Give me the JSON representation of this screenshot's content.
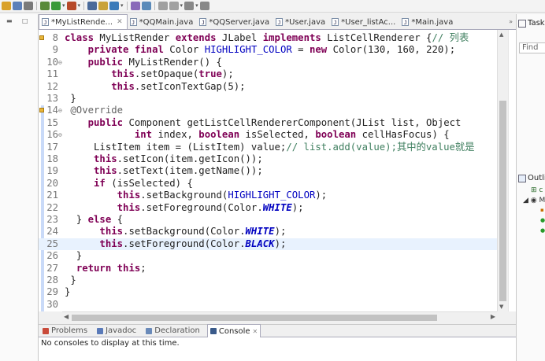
{
  "toolbar": {
    "icons": [
      "new-icon",
      "save-icon",
      "print-icon",
      "debug-icon",
      "run-icon",
      "external-tools-icon",
      "new-java-project-icon",
      "new-package-icon",
      "new-class-icon",
      "open-type-icon",
      "search-icon",
      "prev-annotation-icon",
      "next-annotation-icon",
      "back-icon",
      "forward-icon"
    ]
  },
  "editor": {
    "tabs": [
      {
        "label": "*MyListRende...",
        "active": true
      },
      {
        "label": "*QQMain.java",
        "active": false
      },
      {
        "label": "*QQServer.java",
        "active": false
      },
      {
        "label": "*User.java",
        "active": false
      },
      {
        "label": "*User_listAc...",
        "active": false
      },
      {
        "label": "*Main.java",
        "active": false
      }
    ],
    "overflow_count": "»"
  },
  "code": {
    "lines": [
      {
        "n": "8",
        "text": "class MyListRender extends JLabel implements ListCellRenderer {// 列表"
      },
      {
        "n": "9",
        "text": "    private final Color HIGHLIGHT_COLOR = new Color(130, 160, 220);"
      },
      {
        "n": "10",
        "text": "    public MyListRender() {"
      },
      {
        "n": "11",
        "text": "        this.setOpaque(true);"
      },
      {
        "n": "12",
        "text": "        this.setIconTextGap(5);"
      },
      {
        "n": "13",
        "text": " }"
      },
      {
        "n": "14",
        "text": " @Override"
      },
      {
        "n": "15",
        "text": "    public Component getListCellRendererComponent(JList list, Object"
      },
      {
        "n": "16",
        "text": "            int index, boolean isSelected, boolean cellHasFocus) {"
      },
      {
        "n": "17",
        "text": "     ListItem item = (ListItem) value;// list.add(value);其中的value就是"
      },
      {
        "n": "18",
        "text": "     this.setIcon(item.getIcon());"
      },
      {
        "n": "19",
        "text": "     this.setText(item.getName());"
      },
      {
        "n": "20",
        "text": "     if (isSelected) {"
      },
      {
        "n": "21",
        "text": "         this.setBackground(HIGHLIGHT_COLOR);"
      },
      {
        "n": "22",
        "text": "         this.setForeground(Color.WHITE);"
      },
      {
        "n": "23",
        "text": "  } else {"
      },
      {
        "n": "24",
        "text": "      this.setBackground(Color.WHITE);"
      },
      {
        "n": "25",
        "text": "      this.setForeground(Color.BLACK);"
      },
      {
        "n": "26",
        "text": "  }"
      },
      {
        "n": "27",
        "text": "  return this;"
      },
      {
        "n": "28",
        "text": " }"
      },
      {
        "n": "29",
        "text": "}"
      },
      {
        "n": "30",
        "text": ""
      }
    ],
    "current_line": "25",
    "fold_lines": [
      "10",
      "14",
      "16"
    ],
    "warning_lines": [
      "8",
      "14"
    ]
  },
  "bottom": {
    "tabs": [
      {
        "label": "Problems",
        "icon": "problems-icon",
        "active": false
      },
      {
        "label": "Javadoc",
        "icon": "javadoc-icon",
        "active": false
      },
      {
        "label": "Declaration",
        "icon": "declaration-icon",
        "active": false
      },
      {
        "label": "Console",
        "icon": "console-icon",
        "active": true
      }
    ],
    "console_message": "No consoles to display at this time."
  },
  "right": {
    "task_tab": "Task Li",
    "find_placeholder": "Find",
    "outline_tab": "Outlin"
  },
  "colors": {
    "keyword": "#7f0055",
    "field": "#0000c0",
    "comment": "#3f7f5f",
    "annotation": "#646464",
    "current_line": "#e8f2fe"
  }
}
